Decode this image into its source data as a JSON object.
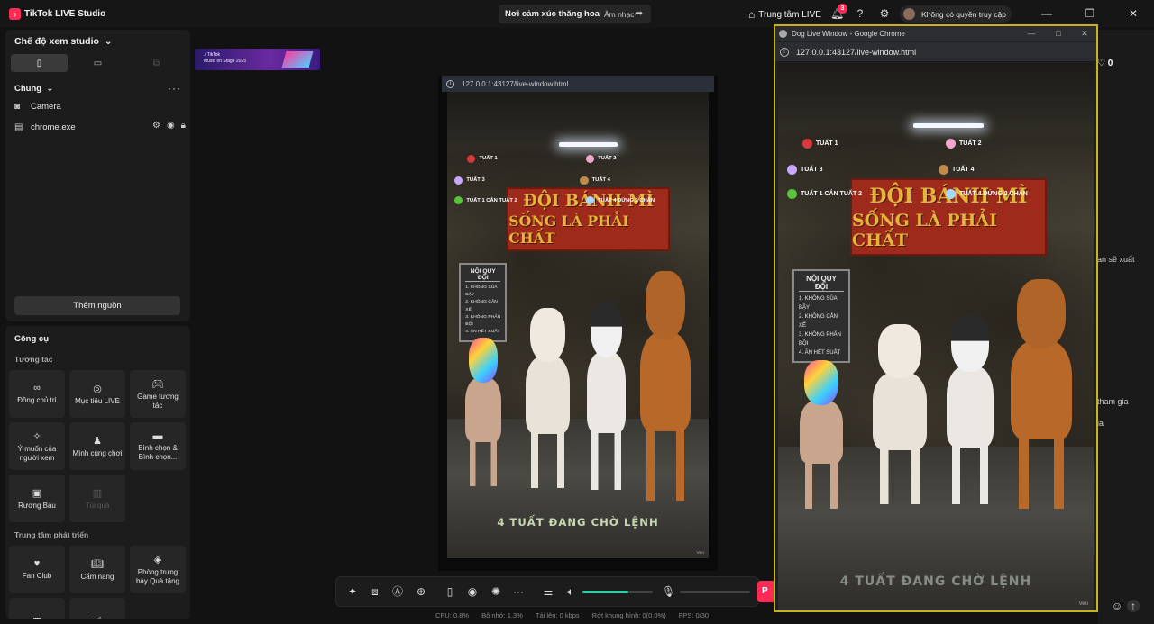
{
  "app": {
    "title": "TikTok LIVE Studio",
    "logo_glyph": "♪",
    "scene_title": "Nơi cảm xúc thăng hoa",
    "scene_category": "Âm nhạc",
    "live_center": "Trung tâm LIVE",
    "notification_count": "3",
    "user_name": "Không có quyền truy cập"
  },
  "left": {
    "studio_mode": "Chế độ xem studio",
    "section_general": "Chung",
    "sources": [
      {
        "name": "Camera",
        "icon": "camera-icon"
      },
      {
        "name": "chrome.exe",
        "icon": "window-icon"
      }
    ],
    "add_source": "Thêm nguồn",
    "tools_title": "Công cụ",
    "interaction_title": "Tương tác",
    "tools": [
      {
        "label": "Đồng chủ trì",
        "icon": "link-icon"
      },
      {
        "label": "Mục tiêu LIVE",
        "icon": "target-icon"
      },
      {
        "label": "Game tương tác",
        "icon": "gamepad-icon"
      },
      {
        "label": "Ý muốn của người xem",
        "icon": "wish-icon"
      },
      {
        "label": "Mình cùng chơi",
        "icon": "play-together-icon"
      },
      {
        "label": "Bình chọn & Bình chọn...",
        "icon": "poll-icon"
      },
      {
        "label": "Rương Báu",
        "icon": "chest-icon"
      },
      {
        "label": "Túi quà",
        "icon": "gift-bag-icon",
        "disabled": true
      }
    ],
    "dev_title": "Trung tâm phát triển",
    "dev_tools": [
      {
        "label": "Fan Club",
        "icon": "heart-icon"
      },
      {
        "label": "Cẩm nang",
        "icon": "book-icon"
      },
      {
        "label": "Phòng trưng bày Quà tặng",
        "icon": "gallery-icon"
      }
    ]
  },
  "promo": {
    "line1": "♪ TikTok",
    "line2": "Music on Stage 2025"
  },
  "preview": {
    "url": "127.0.0.1:43127/live-window.html"
  },
  "scene": {
    "banner_line1": "ĐỘI BÁNH MÌ",
    "banner_line2": "SỐNG LÀ PHẢI CHẤT",
    "rules_title": "NỘI QUY ĐỘI",
    "rules": [
      "1. KHÔNG SỦA BẬY",
      "2. KHÔNG CẮN XẾ",
      "3. KHÔNG PHẢN BỘI",
      "4. ĂN HẾT SUẤT"
    ],
    "tags": [
      "TUẤT 1",
      "TUẤT 2",
      "TUẤT 3",
      "TUẤT 4",
      "TUẤT 1 CẮN TUẤT 2",
      "TUẤT 4 ĐỨNG 2 CHÂN"
    ],
    "waiting": "4 TUẤT ĐANG CHỜ LỆNH",
    "watermark": "Veo"
  },
  "toolbar": {
    "volume_level": 0.65,
    "go_live": "P"
  },
  "status": {
    "cpu": "CPU:  0.8%",
    "memory": "Bộ nhớ:  1.3%",
    "upload": "Tải lên:  0 kbps",
    "dropped": "Rớt khung hình:  0(0.0%)",
    "fps": "FPS:  0/30"
  },
  "right": {
    "likes": "0",
    "snippet1": "an sẽ xuất",
    "snippet2": "tham gia",
    "snippet3": "ia"
  },
  "popup": {
    "window_title": "Dog Live Window - Google Chrome",
    "url": "127.0.0.1:43127/live-window.html"
  },
  "colors": {
    "accent": "#fe2c55",
    "volume": "#2bd4a5",
    "popup_border": "#c9b21a",
    "banner": "#9e2a1c",
    "banner_text": "#e3b53a"
  }
}
